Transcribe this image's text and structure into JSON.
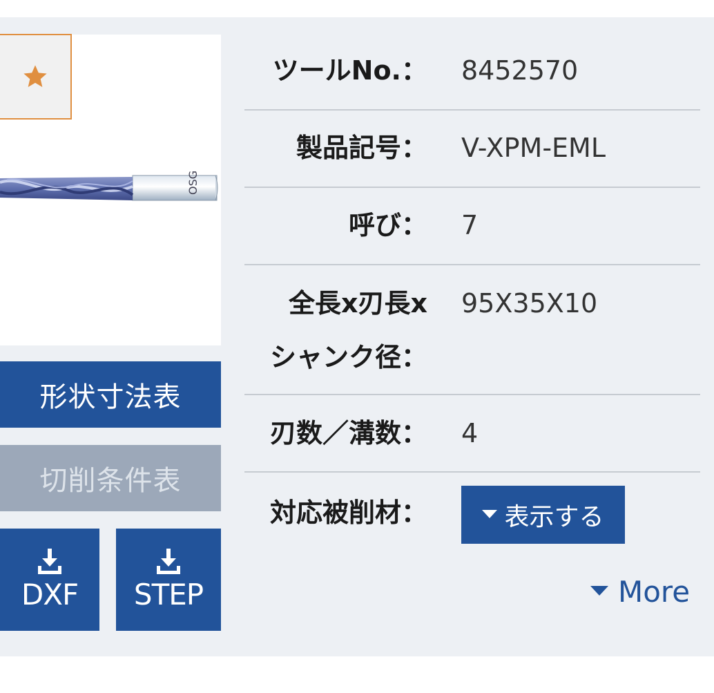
{
  "product": {
    "favorite_icon": "star-icon",
    "image_alt_icon": "drill-icon"
  },
  "buttons": {
    "shape_table": "形状寸法表",
    "cutting_table": "切削条件表",
    "dxf": "DXF",
    "step": "STEP",
    "download_icon": "download-icon"
  },
  "specs": [
    {
      "label": "ツールNo.：",
      "value": "8452570"
    },
    {
      "label": "製品記号：",
      "value": "V-XPM-EML"
    },
    {
      "label": "呼び：",
      "value": "7"
    },
    {
      "label_line1": "全長x刃長x",
      "label_line2": "シャンク径：",
      "value": "95X35X10"
    },
    {
      "label": "刃数／溝数：",
      "value": "4"
    },
    {
      "label": "対応被削材："
    }
  ],
  "show_button": "表示する",
  "more_link": "More",
  "colors": {
    "accent": "#22539a",
    "star": "#e08f40",
    "disabled": "#9ca8b9"
  }
}
